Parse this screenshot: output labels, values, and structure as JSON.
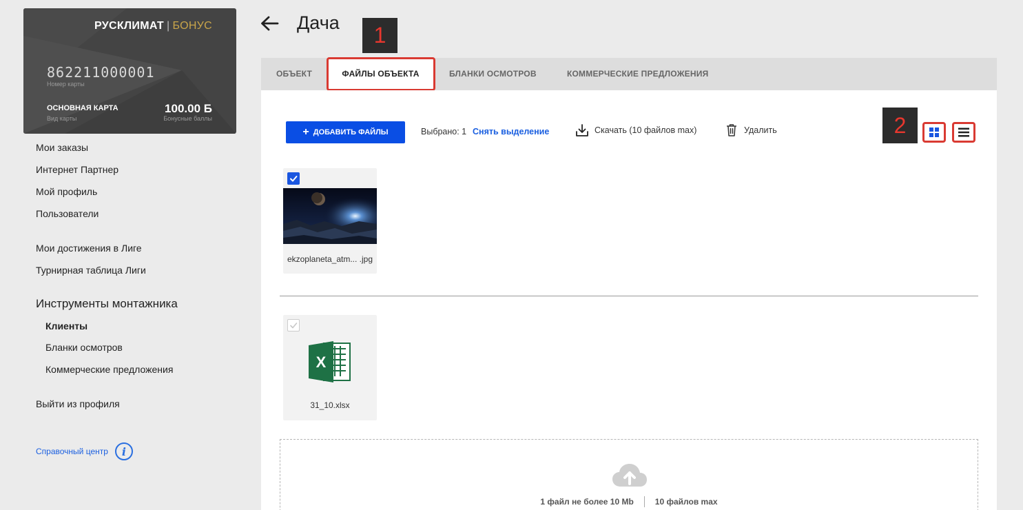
{
  "card": {
    "brand": "РУСКЛИМАТ",
    "brand_sep": "|",
    "brand_bonus": "БОНУС",
    "number": "862211000001",
    "number_label": "Номер карты",
    "type": "ОСНОВНАЯ КАРТА",
    "type_label": "Вид карты",
    "points": "100.00 Б",
    "points_label": "Бонусные баллы"
  },
  "sidebar": {
    "items": [
      "Мои заказы",
      "Интернет Партнер",
      "Мой профиль",
      "Пользователи",
      "Мои достижения в Лиге",
      "Турнирная таблица Лиги"
    ],
    "section_title": "Инструменты монтажника",
    "sub_items": [
      "Клиенты",
      "Бланки осмотров",
      "Коммерческие предложения"
    ],
    "logout": "Выйти из профиля",
    "help": "Справочный центр",
    "help_icon": "i"
  },
  "header": {
    "title": "Дача",
    "back_icon": "arrow-left-icon"
  },
  "markers": [
    "1",
    "2"
  ],
  "tabs": [
    {
      "label": "ОБЪЕКТ"
    },
    {
      "label": "ФАЙЛЫ ОБЪЕКТА"
    },
    {
      "label": "БЛАНКИ ОСМОТРОВ"
    },
    {
      "label": "КОММЕРЧЕСКИЕ ПРЕДЛОЖЕНИЯ"
    }
  ],
  "toolbar": {
    "add_label": "ДОБАВИТЬ ФАЙЛЫ",
    "add_icon": "+",
    "selected": "Выбрано: 1",
    "deselect": "Снять выделение",
    "download": "Скачать (10 файлов max)",
    "delete": "Удалить"
  },
  "files": [
    {
      "name": "ekzoplaneta_atm... .jpg",
      "checked": true,
      "type": "image"
    },
    {
      "name": "31_10.xlsx",
      "checked": false,
      "type": "excel",
      "icon_letter": "X"
    }
  ],
  "dropzone": {
    "limit_size": "1 файл не более 10 Mb",
    "limit_count": "10 файлов max"
  },
  "colors": {
    "primary": "#0a4ee4",
    "link": "#1a5fe0",
    "highlight": "#d93a32",
    "card_bg": "#444444",
    "gold": "#c9a54a",
    "excel_green": "#1e7145"
  }
}
